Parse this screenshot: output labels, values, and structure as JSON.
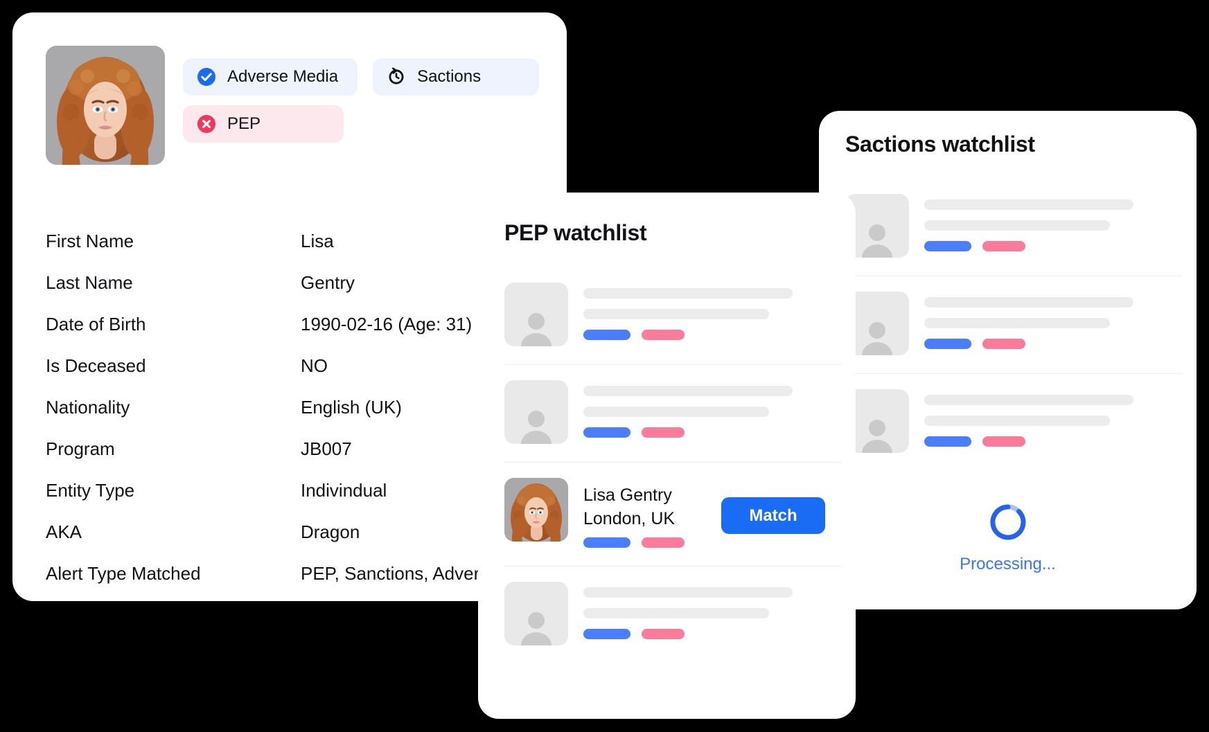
{
  "profile": {
    "photo": {
      "icon": "portrait-photo",
      "alt": "Portrait of a woman with curly auburn hair"
    },
    "badges": [
      {
        "label": "Adverse Media",
        "icon": "check-circle-icon",
        "style": "blue",
        "bg": "#eef3fe",
        "icon_color": "#1a6cf5"
      },
      {
        "label": "Sactions",
        "icon": "history-clock-icon",
        "style": "plain",
        "bg": "#eef3fe",
        "icon_color": "#111217"
      },
      {
        "label": "PEP",
        "icon": "x-circle-icon",
        "style": "pink",
        "bg": "#fde9ed",
        "icon_color": "#f5365c"
      }
    ],
    "details": [
      {
        "label": "First Name",
        "value": "Lisa"
      },
      {
        "label": "Last Name",
        "value": "Gentry"
      },
      {
        "label": "Date of Birth",
        "value": "1990-02-16 (Age: 31)"
      },
      {
        "label": "Is Deceased",
        "value": "NO"
      },
      {
        "label": "Nationality",
        "value": "English (UK)"
      },
      {
        "label": "Program",
        "value": "JB007"
      },
      {
        "label": "Entity Type",
        "value": "Indivindual"
      },
      {
        "label": "AKA",
        "value": "Dragon"
      },
      {
        "label": "Alert Type Matched",
        "value": "PEP, Sanctions, Adverse Media"
      }
    ]
  },
  "pep_watchlist": {
    "title": "PEP watchlist",
    "rows": [
      {
        "type": "skeleton"
      },
      {
        "type": "skeleton"
      },
      {
        "type": "matched",
        "name": "Lisa Gentry",
        "location": "London, UK",
        "button_label": "Match"
      },
      {
        "type": "skeleton"
      }
    ]
  },
  "sanctions_watchlist": {
    "title": "Sactions watchlist",
    "rows": [
      {
        "type": "skeleton"
      },
      {
        "type": "skeleton"
      },
      {
        "type": "skeleton"
      }
    ],
    "status": {
      "label": "Processing...",
      "icon": "loading-spinner-icon",
      "color": "#3b76ef"
    }
  },
  "colors": {
    "accent_blue": "#1a6cf5",
    "pill_blue": "#4a7efc",
    "pill_pink": "#fb7c9a",
    "danger": "#f5365c",
    "skeleton_gray": "#ececed",
    "avatar_gray": "#e9e9ea",
    "card_white": "#ffffff",
    "background": "#000000",
    "text": "#111217"
  }
}
